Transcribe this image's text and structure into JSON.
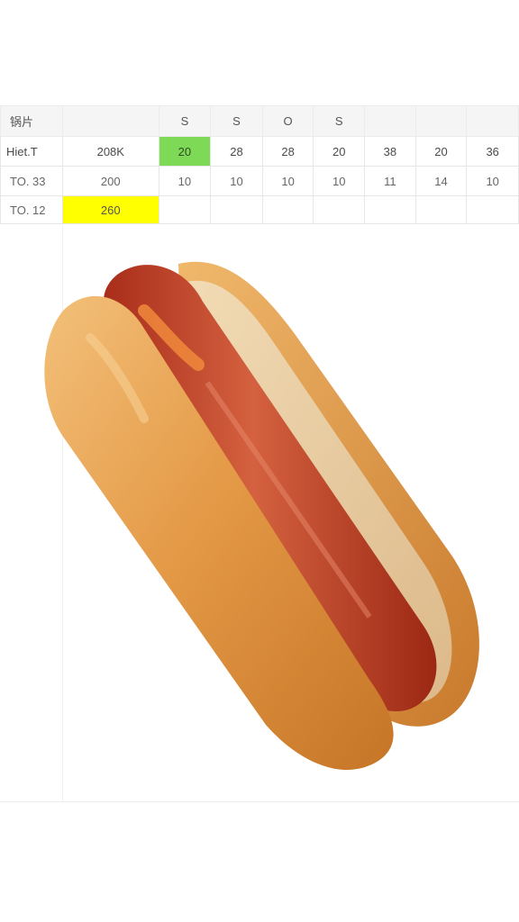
{
  "sheet": {
    "header": [
      "锅片",
      "",
      "S",
      "S",
      "O",
      "S",
      "",
      "",
      ""
    ],
    "rows": [
      {
        "label": "Hiet.T",
        "cells": [
          "208K",
          "20",
          "28",
          "28",
          "20",
          "38",
          "20",
          "36"
        ]
      },
      {
        "label": "TO. 33",
        "cells": [
          "200",
          "10",
          "10",
          "10",
          "10",
          "11",
          "14",
          "10"
        ]
      },
      {
        "label": "TO. 12",
        "cells": [
          "260",
          "",
          "",
          "",
          "",
          "",
          "",
          ""
        ]
      }
    ],
    "highlights": {
      "green": "#7ed957",
      "yellow": "#ffff00"
    }
  },
  "photo": {
    "subject": "hot-dog-image"
  }
}
